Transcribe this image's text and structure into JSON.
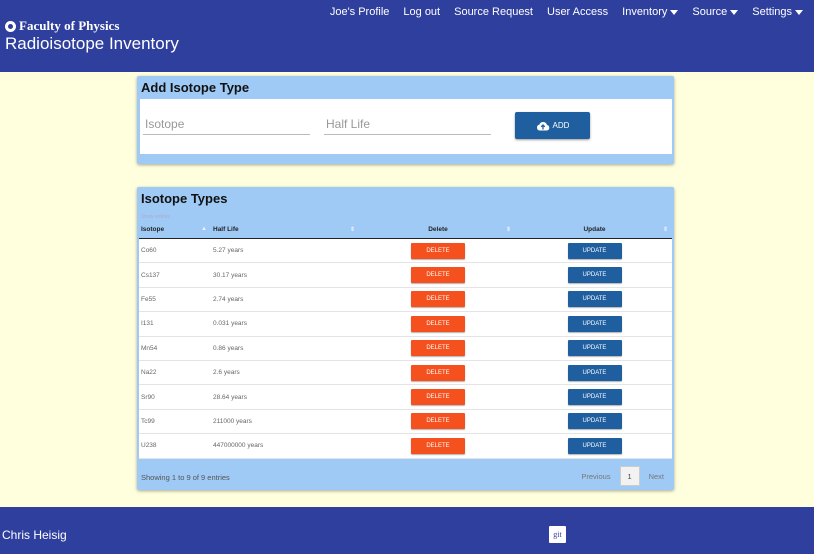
{
  "header": {
    "brand": "Faculty of Physics",
    "brand_icon": "atom-icon",
    "title": "Radioisotope Inventory",
    "nav": [
      {
        "label": "Joe's Profile",
        "dropdown": false
      },
      {
        "label": "Log out",
        "dropdown": false
      },
      {
        "label": "Source Request",
        "dropdown": false
      },
      {
        "label": "User Access",
        "dropdown": false
      },
      {
        "label": "Inventory",
        "dropdown": true
      },
      {
        "label": "Source",
        "dropdown": true
      },
      {
        "label": "Settings",
        "dropdown": true
      }
    ]
  },
  "add_panel": {
    "title": "Add Isotope Type",
    "isotope_placeholder": "Isotope",
    "half_life_placeholder": "Half Life",
    "add_label": "ADD"
  },
  "list_panel": {
    "title": "Isotope Types",
    "show_entries": "Show entries",
    "columns": [
      "Isotope",
      "Half Life",
      "Delete",
      "Update"
    ],
    "rows": [
      {
        "isotope": "Co60",
        "half_life": "5.27 years"
      },
      {
        "isotope": "Cs137",
        "half_life": "30.17 years"
      },
      {
        "isotope": "Fe55",
        "half_life": "2.74 years"
      },
      {
        "isotope": "I131",
        "half_life": "0.031 years"
      },
      {
        "isotope": "Mn54",
        "half_life": "0.86 years"
      },
      {
        "isotope": "Na22",
        "half_life": "2.6 years"
      },
      {
        "isotope": "Sr90",
        "half_life": "28.64 years"
      },
      {
        "isotope": "Tc99",
        "half_life": "211000 years"
      },
      {
        "isotope": "U238",
        "half_life": "447000000 years"
      }
    ],
    "delete_label": "DELETE",
    "update_label": "UPDATE",
    "info": "Showing 1 to 9 of 9 entries",
    "previous": "Previous",
    "page": "1",
    "next": "Next"
  },
  "footer": {
    "name": "Chris Heisig",
    "git": "git"
  },
  "colors": {
    "header_bg": "#2f3f9e",
    "panel_bg": "#9fcaf5",
    "page_bg": "#ffffde",
    "delete": "#f4511e",
    "update": "#1f5f9f"
  }
}
